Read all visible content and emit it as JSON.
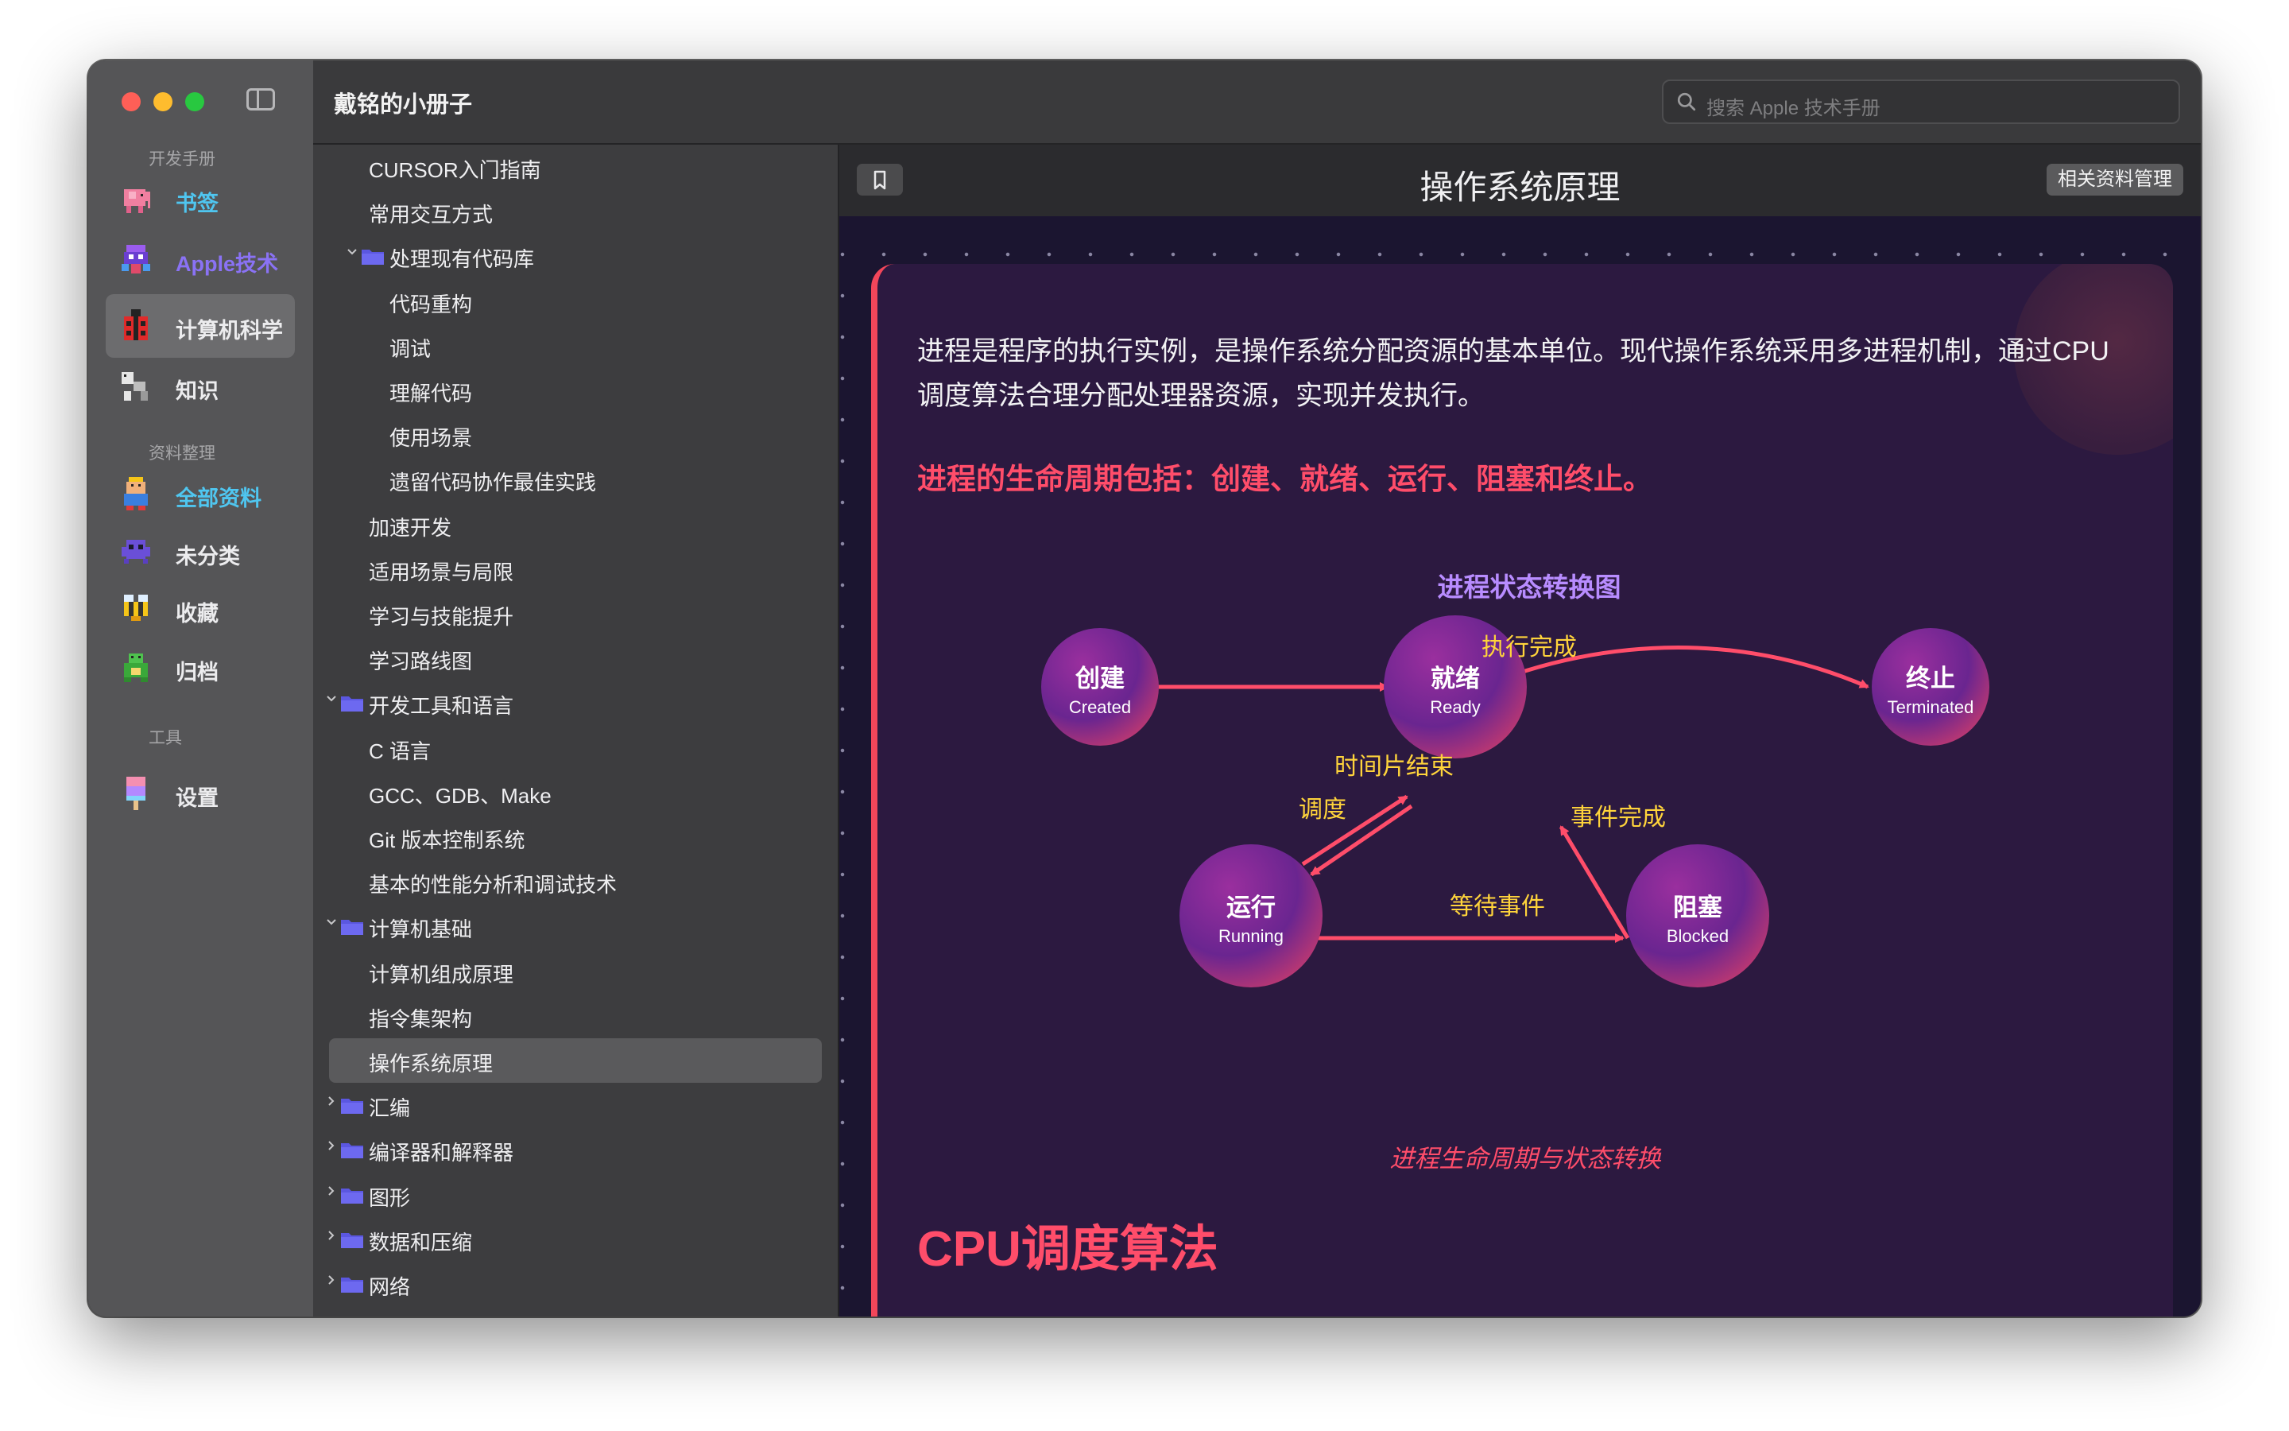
{
  "app": {
    "title": "戴铭的小册子",
    "search_placeholder": "搜索 Apple 技术手册"
  },
  "sidebar": {
    "sections": [
      {
        "label": "开发手册",
        "items": [
          {
            "label": "书签",
            "color": "#4fc6f0",
            "icon": "pink-elephant-icon"
          },
          {
            "label": "Apple技术",
            "color": "#8a72f5",
            "icon": "space-invader-icon"
          },
          {
            "label": "计算机科学",
            "color": "#ececee",
            "icon": "ladybug-icon",
            "active": true
          },
          {
            "label": "知识",
            "color": "#ececee",
            "icon": "pixel-robot-icon"
          }
        ]
      },
      {
        "label": "资料整理",
        "items": [
          {
            "label": "全部资料",
            "color": "#4fc6f0",
            "icon": "pixel-king-icon"
          },
          {
            "label": "未分类",
            "color": "#ececee",
            "icon": "purple-alien-icon"
          },
          {
            "label": "收藏",
            "color": "#ececee",
            "icon": "bee-icon"
          },
          {
            "label": "归档",
            "color": "#ececee",
            "icon": "frog-icon"
          }
        ]
      },
      {
        "label": "工具",
        "items": [
          {
            "label": "设置",
            "color": "#ececee",
            "icon": "popsicle-icon"
          }
        ]
      }
    ]
  },
  "tree": {
    "items": [
      {
        "label": "CURSOR入门指南",
        "level": 3
      },
      {
        "label": "常用交互方式",
        "level": 3
      },
      {
        "label": "处理现有代码库",
        "level": 2,
        "folder": true,
        "expanded": true
      },
      {
        "label": "代码重构",
        "level": 4
      },
      {
        "label": "调试",
        "level": 4
      },
      {
        "label": "理解代码",
        "level": 4
      },
      {
        "label": "使用场景",
        "level": 4
      },
      {
        "label": "遗留代码协作最佳实践",
        "level": 4
      },
      {
        "label": "加速开发",
        "level": 3
      },
      {
        "label": "适用场景与局限",
        "level": 3
      },
      {
        "label": "学习与技能提升",
        "level": 3
      },
      {
        "label": "学习路线图",
        "level": 3
      },
      {
        "label": "开发工具和语言",
        "level": 1,
        "folder": true,
        "expanded": true
      },
      {
        "label": "C 语言",
        "level": 2
      },
      {
        "label": "GCC、GDB、Make",
        "level": 2
      },
      {
        "label": "Git 版本控制系统",
        "level": 2
      },
      {
        "label": "基本的性能分析和调试技术",
        "level": 2
      },
      {
        "label": "计算机基础",
        "level": 1,
        "folder": true,
        "expanded": true
      },
      {
        "label": "计算机组成原理",
        "level": 2
      },
      {
        "label": "指令集架构",
        "level": 2
      },
      {
        "label": "操作系统原理",
        "level": 2,
        "selected": true
      },
      {
        "label": "汇编",
        "level": 1,
        "folder": true,
        "expanded": false
      },
      {
        "label": "编译器和解释器",
        "level": 1,
        "folder": true,
        "expanded": false
      },
      {
        "label": "图形",
        "level": 1,
        "folder": true,
        "expanded": false
      },
      {
        "label": "数据和压缩",
        "level": 1,
        "folder": true,
        "expanded": false
      },
      {
        "label": "网络",
        "level": 1,
        "folder": true,
        "expanded": false
      }
    ]
  },
  "content": {
    "title": "操作系统原理",
    "related_button": "相关资料管理",
    "paragraph": "进程是程序的执行实例，是操作系统分配资源的基本单位。现代操作系统采用多进程机制，通过CPU调度算法合理分配处理器资源，实现并发执行。",
    "highlight": "进程的生命周期包括：创建、就绪、运行、阻塞和终止。",
    "diagram": {
      "title": "进程状态转换图",
      "states": {
        "created": {
          "zh": "创建",
          "en": "Created"
        },
        "ready": {
          "zh": "就绪",
          "en": "Ready"
        },
        "terminated": {
          "zh": "终止",
          "en": "Terminated"
        },
        "running": {
          "zh": "运行",
          "en": "Running"
        },
        "blocked": {
          "zh": "阻塞",
          "en": "Blocked"
        }
      },
      "transitions": {
        "exec_done": "执行完成",
        "time_slice": "时间片结束",
        "schedule": "调度",
        "event_done": "事件完成",
        "wait_event": "等待事件"
      }
    },
    "caption": "进程生命周期与状态转换",
    "section_heading": "CPU调度算法"
  },
  "colors": {
    "accent": "#ff4d6a",
    "diagram_title": "#b88cff",
    "label_yellow": "#ffd43b",
    "card_bg": "#2c1940"
  }
}
